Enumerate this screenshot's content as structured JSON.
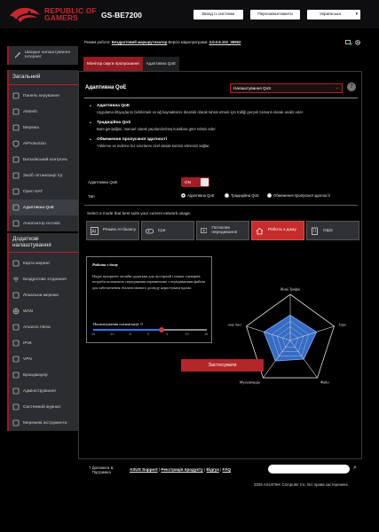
{
  "header": {
    "brand_line1": "REPUBLIC OF",
    "brand_line2": "GAMERS",
    "model": "GS-BE7200",
    "logout_label": "Вихід із системи",
    "reboot_label": "Перезавантажити",
    "language_value": "Українська"
  },
  "status": {
    "mode_label": "Режим роботи:",
    "mode_value": "Бездротовий маршрутизатор",
    "fw_label": "Версія мікропрограми:",
    "fw_value": "3.0.0.6.102_38952",
    "icons": [
      "devices-icon",
      "settings-icon"
    ]
  },
  "sidebar": {
    "top_item": "Швидке налаштування Інтернет",
    "general_title": "Загальний",
    "general_items": [
      {
        "label": "Панель керування",
        "icon": "dashboard-icon"
      },
      {
        "label": "AiMesh",
        "icon": "aimesh-icon"
      },
      {
        "label": "Мережа",
        "icon": "network-icon"
      },
      {
        "label": "AiProtection",
        "icon": "shield-icon"
      },
      {
        "label": "Батьківський контроль",
        "icon": "parental-icon"
      },
      {
        "label": "Засіб оптимізації ігр",
        "icon": "game-icon"
      },
      {
        "label": "Open NAT",
        "icon": "nat-icon"
      },
      {
        "label": "Адаптивна QoE",
        "icon": "qoe-icon"
      },
      {
        "label": "Аналізатор потоків",
        "icon": "traffic-icon"
      }
    ],
    "advanced_title": "Додаткові налаштування",
    "advanced_items": [
      {
        "label": "Карта мережі",
        "icon": "map-icon"
      },
      {
        "label": "Бездротове з'єднання",
        "icon": "wifi-icon"
      },
      {
        "label": "Локальна мережа",
        "icon": "lan-icon"
      },
      {
        "label": "WAN",
        "icon": "globe-icon"
      },
      {
        "label": "Amazon Alexa",
        "icon": "alexa-icon"
      },
      {
        "label": "IPv6",
        "icon": "ipv6-icon"
      },
      {
        "label": "VPN",
        "icon": "vpn-icon"
      },
      {
        "label": "Брандмауер",
        "icon": "firewall-icon"
      },
      {
        "label": "Адміністрування",
        "icon": "admin-icon"
      },
      {
        "label": "Системний журнал",
        "icon": "log-icon"
      },
      {
        "label": "Мережеві інструменти",
        "icon": "tools-icon"
      }
    ]
  },
  "tabs": [
    {
      "label": "Монітор смуги пропускання"
    },
    {
      "label": "Адаптивна QoE"
    }
  ],
  "panel": {
    "title": "Адаптивна QoE",
    "dropdown_value": "Налаштування QoS",
    "help_label": "?",
    "bullets": [
      {
        "title": "Адаптивна QoE",
        "text": "Uygulama ihtiyaçlarını belirlemek ve ağ kaynaklarını dinamik olarak tahsis etmek için trafiği gerçek zamanlı olarak analiz eder."
      },
      {
        "title": "Традиційна QoS",
        "text": "Bant genişliğini, manuel olarak yapılandırılmış kurallara göre tahsis eder."
      },
      {
        "title": "Обмеження пропускної здатності",
        "text": "Yükleme ve indirme hız sınırlarını özel olarak kontrol etmenizi sağlar."
      }
    ],
    "enable_label": "Адаптивна QoE",
    "toggle_text": "ON",
    "type_label": "Тип",
    "radio_options": [
      "Адаптивна QoE",
      "Традиційна QoS",
      "Обмеження пропускної здатності"
    ],
    "modes_label": "Select a mode that best suits your current network usage.",
    "modes": [
      {
        "label": "Режим AI-базису",
        "icon": "ai-icon"
      },
      {
        "label": "Ігри",
        "icon": "gamepad-icon"
      },
      {
        "label": "Потокове передавання",
        "icon": "streaming-icon"
      },
      {
        "label": "Робота з дому",
        "icon": "home-work-icon"
      },
      {
        "label": "Офіс",
        "icon": "office-icon"
      }
    ],
    "card": {
      "title": "Робота з дому",
      "description": "Надає пріоритет онлайн-додаткам для пустірчий і інших сценаріїв потреби потокового передавання перевантаже з передаванням файлів для забезпечення збалансованого досвіду користувача вдома.",
      "slider_label": "Налаштування оптимізації: 0",
      "slider_fraction": 0.6,
      "ticks": [
        "-15",
        "-10",
        "-5",
        "0",
        "5",
        "10",
        "15"
      ]
    },
    "radar": {
      "axes": [
        "Живі Трафік",
        "Ігри",
        "Файл",
        "Мультимедіа",
        "У реальному часі"
      ],
      "values": [
        0.55,
        0.6,
        0.5,
        0.55,
        0.6
      ]
    },
    "apply_label": "Застосувати"
  },
  "footer": {
    "help_label": "Допомога & Підтримка",
    "links": [
      "ASUS Support",
      "Реєстрація продукту",
      "Відгук",
      "FAQ"
    ],
    "copyright": "2026 ASUSTeK Computer Inc. Всі права застережені."
  },
  "colors": {
    "accent": "#b3262a",
    "background": "#000000",
    "sidebar": "#2b2d31"
  }
}
